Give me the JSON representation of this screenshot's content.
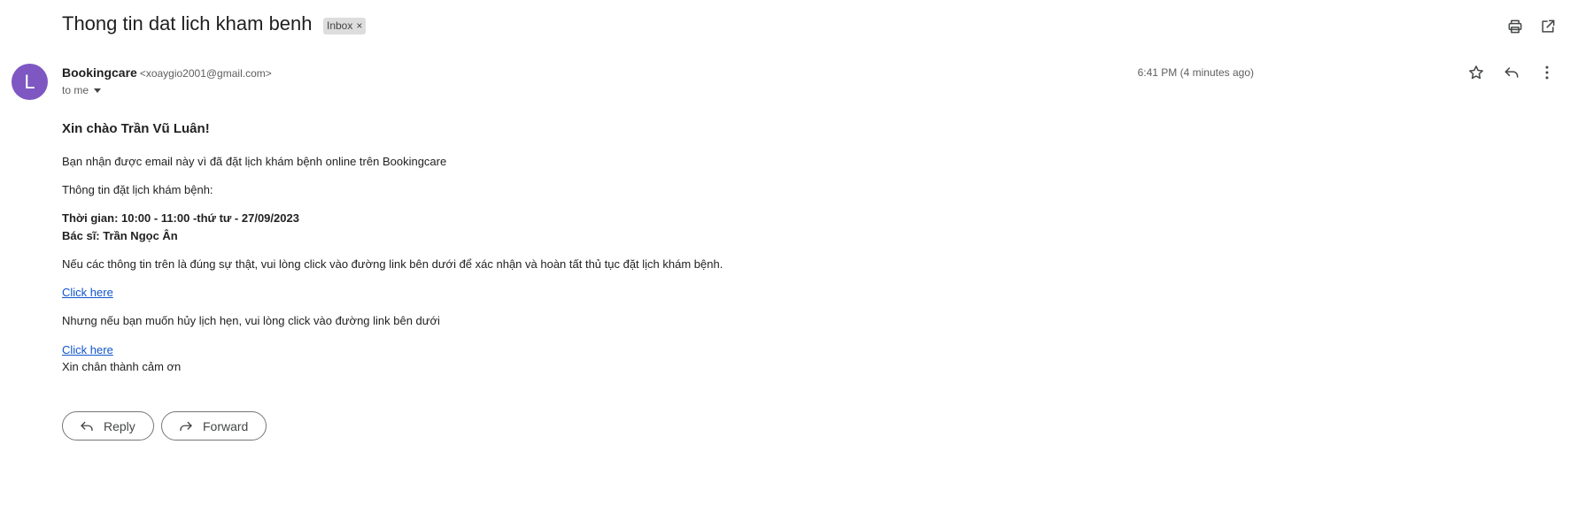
{
  "email": {
    "subject": "Thong tin dat lich kham benh",
    "label_chip": "Inbox",
    "label_remove": "×",
    "avatar_letter": "L",
    "avatar_color": "#7e57c2",
    "sender_name": "Bookingcare",
    "sender_email": "<xoaygio2001@gmail.com>",
    "recipient": "to me",
    "timestamp": "6:41 PM (4 minutes ago)"
  },
  "header_actions": {
    "print_icon": "print-icon",
    "open_new_window_icon": "open-in-new-window-icon"
  },
  "message_actions": {
    "star_icon": "star-icon",
    "reply_icon": "reply-icon",
    "more_icon": "more-vertical-icon"
  },
  "body": {
    "greeting": "Xin chào Trần Vũ Luân!",
    "intro": "Bạn nhận được email này vì đã đặt lịch khám bệnh online trên Bookingcare",
    "info_heading": "Thông tin đặt lịch khám bệnh:",
    "time_line": "Thời gian: 10:00 - 11:00 -thứ tư - 27/09/2023",
    "doctor_line": "Bác sĩ: Trần Ngọc Ân",
    "confirm_text": "Nếu các thông tin trên là đúng sự thật, vui lòng click vào đường link bên dưới để xác nhận và hoàn tất thủ tục đặt lịch khám bệnh.",
    "confirm_link": "Click here",
    "cancel_text": "Nhưng nếu bạn muốn hủy lịch hẹn, vui lòng click vào đường link bên dưới",
    "cancel_link": "Click here",
    "closing": "Xin chân thành cảm ơn"
  },
  "footer_buttons": {
    "reply_label": "Reply",
    "forward_label": "Forward"
  },
  "colors": {
    "link": "#1155cc",
    "avatar": "#7e57c2",
    "chip_bg": "#dddddd"
  }
}
